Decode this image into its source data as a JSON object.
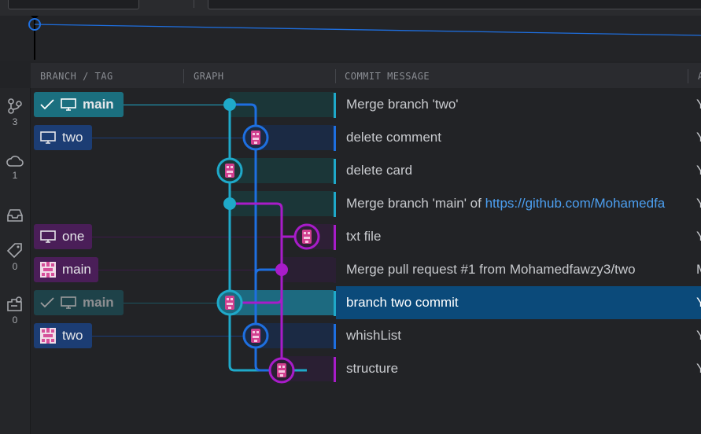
{
  "columns": {
    "branch_tag": "BRANCH / TAG",
    "graph": "GRAPH",
    "commit_message": "COMMIT MESSAGE",
    "author_partial": "A"
  },
  "sidebar": {
    "items": [
      {
        "icon": "branches-icon",
        "count": "3"
      },
      {
        "icon": "cloud-icon",
        "count": "1"
      },
      {
        "icon": "inbox-icon",
        "count": ""
      },
      {
        "icon": "tag-icon",
        "count": "0"
      },
      {
        "icon": "stash-icon",
        "count": "0"
      }
    ]
  },
  "commits": [
    {
      "message": "Merge branch 'two'",
      "author": "Y",
      "refs": [
        {
          "label": "main",
          "type": "local-current",
          "icon": "monitor-icon"
        }
      ]
    },
    {
      "message": "delete comment",
      "author": "Y",
      "refs": [
        {
          "label": "two",
          "type": "local",
          "icon": "monitor-icon"
        }
      ]
    },
    {
      "message": "delete card",
      "author": "Y",
      "refs": []
    },
    {
      "message": "Merge branch 'main' of ",
      "link": "https://github.com/Mohamedfa",
      "author": "Y",
      "refs": []
    },
    {
      "message": "txt file",
      "author": "Y",
      "refs": [
        {
          "label": "one",
          "type": "local",
          "icon": "monitor-icon"
        }
      ]
    },
    {
      "message": "Merge pull request #1 from Mohamedfawzy3/two",
      "author": "M",
      "refs": [
        {
          "label": "main",
          "type": "remote",
          "icon": "avatar-icon"
        }
      ]
    },
    {
      "message": "branch two commit",
      "author": "Y",
      "selected": true,
      "refs": [
        {
          "label": "main",
          "type": "local-current-dim",
          "icon": "monitor-icon"
        }
      ]
    },
    {
      "message": "whishList",
      "author": "Y",
      "refs": [
        {
          "label": "two",
          "type": "remote",
          "icon": "avatar-icon"
        }
      ]
    },
    {
      "message": "structure",
      "author": "Y",
      "refs": []
    }
  ],
  "colors": {
    "lane_cyan": "#1fa9c9",
    "lane_blue": "#1e6fe0",
    "lane_purple": "#a81cc9",
    "selected_row": "#0b4a7a",
    "link": "#4c9ff0"
  }
}
